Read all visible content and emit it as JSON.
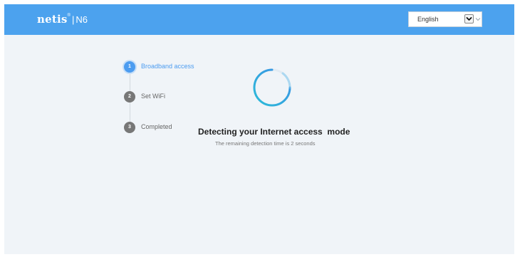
{
  "header": {
    "brand_name": "netis",
    "brand_reg": "®",
    "separator": "|",
    "model": "N6",
    "language": {
      "selected": "English"
    }
  },
  "steps": [
    {
      "number": "1",
      "label": "Broadband access",
      "state": "active"
    },
    {
      "number": "2",
      "label": "Set WiFi",
      "state": "inactive"
    },
    {
      "number": "3",
      "label": "Completed",
      "state": "inactive"
    }
  ],
  "main": {
    "title": "Detecting your Internet access  mode",
    "subtitle": "The remaining detection time is 2 seconds"
  },
  "colors": {
    "header_bg": "#4ca2ee",
    "page_bg": "#f0f4f8",
    "active_step": "#4c9cf0",
    "inactive_step": "#777777",
    "spinner_start": "#2bbcd8",
    "spinner_end": "#3d8fe6"
  },
  "icons": {
    "spinner": "loading-spinner-icon",
    "select_arrow": "chevron-down-icon"
  }
}
